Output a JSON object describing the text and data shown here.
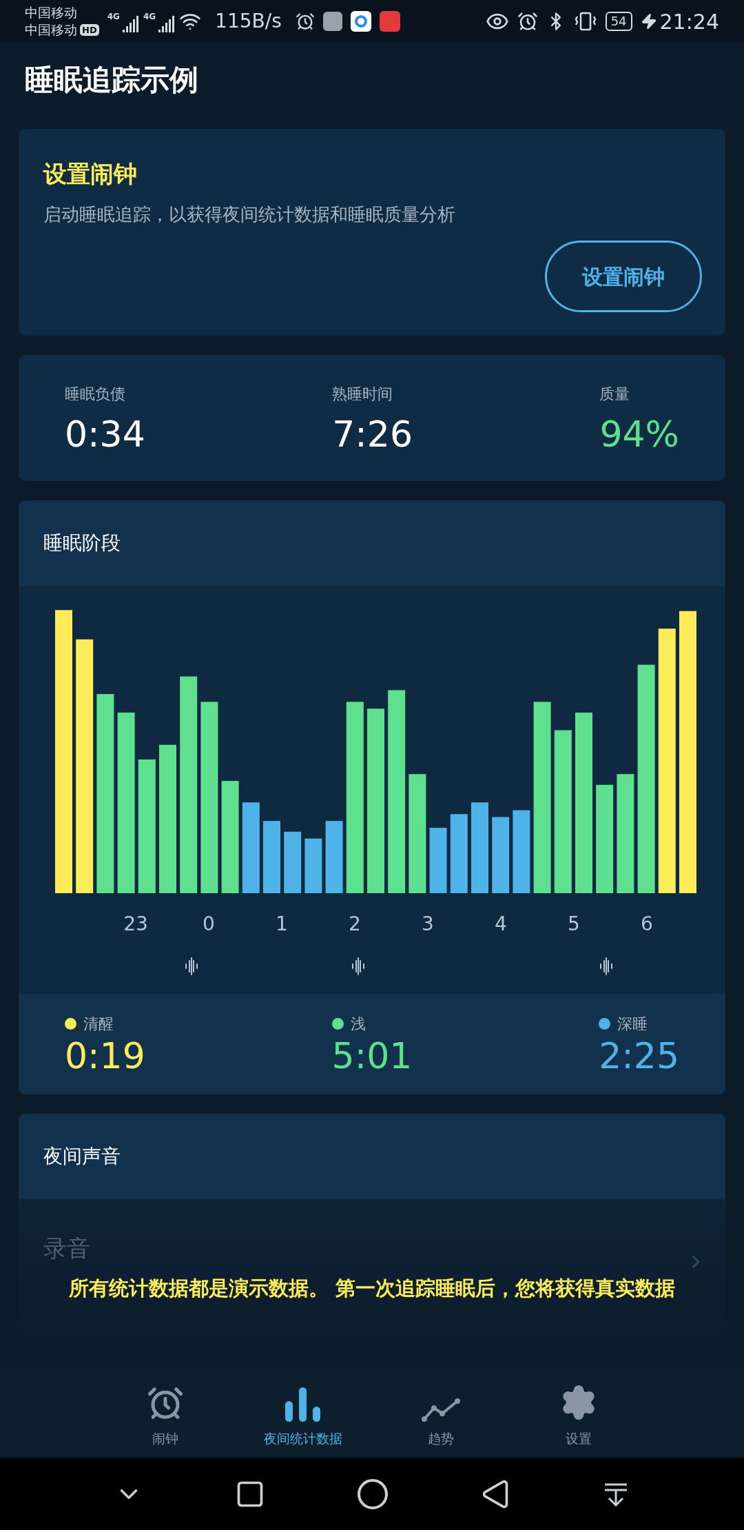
{
  "status_bar": {
    "carrier_1": "中国移动",
    "carrier_2": "中国移动",
    "hd": "HD",
    "net_1": "4G",
    "net_2": "4G",
    "speed": "115B/s",
    "battery": "54",
    "time": "21:24"
  },
  "app_bar": {
    "title": "睡眠追踪示例"
  },
  "alarm_card": {
    "title": "设置闹钟",
    "description": "启动睡眠追踪，以获得夜间统计数据和睡眠质量分析",
    "button": "设置闹钟"
  },
  "stats": [
    {
      "label": "睡眠负债",
      "value": "0:34",
      "color": "#ffffff"
    },
    {
      "label": "熟睡时间",
      "value": "7:26",
      "color": "#ffffff"
    },
    {
      "label": "质量",
      "value": "94%",
      "color": "#5ee08f"
    }
  ],
  "stages_card": {
    "title": "睡眠阶段",
    "hours": [
      "23",
      "0",
      "1",
      "2",
      "3",
      "4",
      "5",
      "6"
    ],
    "legend": [
      {
        "label": "清醒",
        "value": "0:19",
        "color": "#fdec5a"
      },
      {
        "label": "浅",
        "value": "5:01",
        "color": "#5ee08f"
      },
      {
        "label": "深睡",
        "value": "2:25",
        "color": "#4fb3ea"
      }
    ]
  },
  "sounds_card": {
    "title": "夜间声音",
    "recording_title": "录音"
  },
  "toast": "所有统计数据都是演示数据。 第一次追踪睡眠后，您将获得真实数据",
  "bottom_nav": [
    {
      "label": "闹钟",
      "selected": false
    },
    {
      "label": "夜间统计数据",
      "selected": true
    },
    {
      "label": "趋势",
      "selected": false
    },
    {
      "label": "设置",
      "selected": false
    }
  ]
}
